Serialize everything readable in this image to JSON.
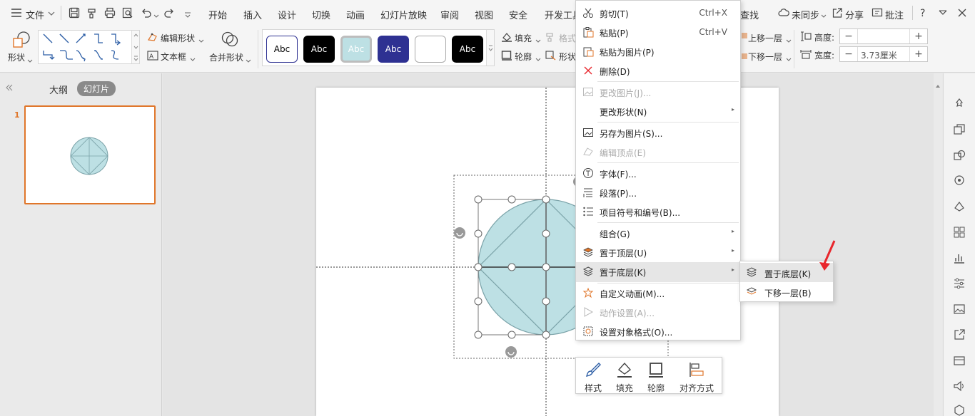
{
  "menubar": {
    "file": "文件",
    "tabs": [
      "开始",
      "插入",
      "设计",
      "切换",
      "动画",
      "幻灯片放映",
      "审阅",
      "视图",
      "安全",
      "开发工具"
    ],
    "search": "查找",
    "sync": "未同步",
    "share": "分享",
    "comment": "批注"
  },
  "ribbon": {
    "shape": "形状",
    "edit_shape": "编辑形状",
    "textbox": "文本框",
    "merge_shapes": "合并形状",
    "style_swatches": [
      {
        "label": "Abc",
        "bg": "#ffffff",
        "fg": "#000000",
        "border": "#2e3192"
      },
      {
        "label": "Abc",
        "bg": "#000000",
        "fg": "#ffffff",
        "border": "#000000"
      },
      {
        "label": "Abc",
        "bg": "#bde0e4",
        "fg": "#ffffff",
        "border": "#9aa9ab"
      },
      {
        "label": "Abc",
        "bg": "#2e3192",
        "fg": "#ffffff",
        "border": "#2e3192"
      },
      {
        "label": "",
        "bg": "#ffffff",
        "fg": "#000000",
        "border": "#999999"
      },
      {
        "label": "Abc",
        "bg": "#000000",
        "fg": "#ffffff",
        "border": "#000000"
      }
    ],
    "fill": "填充",
    "format": "格式",
    "outline": "轮廓",
    "shape_effect": "形状",
    "bring_forward": "上移一层",
    "send_backward": "下移一层",
    "height_label": "高度:",
    "width_label": "宽度:",
    "height_value": "",
    "width_value": "3.73厘米"
  },
  "left_panel": {
    "outline_tab": "大纲",
    "slides_tab": "幻灯片",
    "slide_number": "1"
  },
  "context_menu": {
    "cut": "剪切(T)",
    "cut_shortcut": "Ctrl+X",
    "paste": "粘贴(P)",
    "paste_shortcut": "Ctrl+V",
    "paste_as_picture": "粘贴为图片(P)",
    "delete": "删除(D)",
    "change_picture": "更改图片(J)...",
    "change_shape": "更改形状(N)",
    "save_as_picture": "另存为图片(S)...",
    "edit_points": "编辑顶点(E)",
    "font": "字体(F)...",
    "paragraph": "段落(P)...",
    "bullets": "项目符号和编号(B)...",
    "group": "组合(G)",
    "bring_to_front": "置于顶层(U)",
    "send_to_back": "置于底层(K)",
    "custom_animation": "自定义动画(M)...",
    "action_settings": "动作设置(A)...",
    "format_object": "设置对象格式(O)..."
  },
  "submenu": {
    "send_to_back": "置于底层(K)",
    "send_backward": "下移一层(B)"
  },
  "float_toolbar": {
    "style": "样式",
    "fill": "填充",
    "outline": "轮廓",
    "align": "对齐方式"
  },
  "colors": {
    "shape_fill": "#bde0e4",
    "shape_stroke": "#7aa2a8",
    "accent_orange": "#e0762a",
    "arrow_red": "#e8262c"
  }
}
